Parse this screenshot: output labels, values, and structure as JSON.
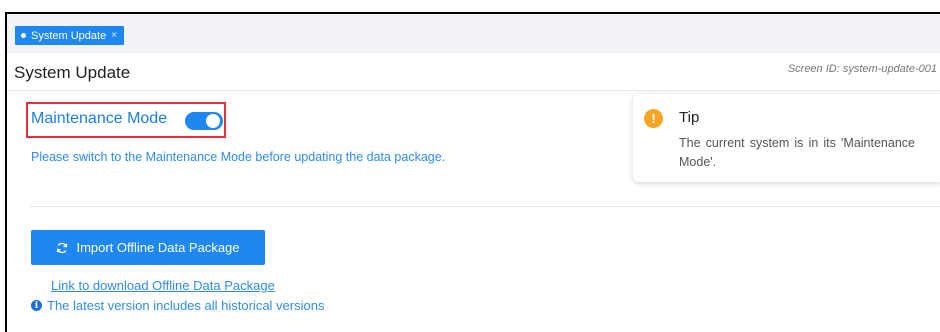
{
  "tab": {
    "label": "System Update",
    "close": "×"
  },
  "header": {
    "title": "System Update",
    "screen_id": "Screen ID: system-update-001"
  },
  "maintenance": {
    "label": "Maintenance Mode",
    "enabled": true,
    "hint": "Please switch to the Maintenance Mode before updating the data package."
  },
  "actions": {
    "import_label": "Import Offline Data Package",
    "download_link": "Link to download Offline Data Package",
    "info_text": "The latest version includes all historical versions"
  },
  "tip": {
    "title": "Tip",
    "text": "The current system is in its 'Maintenance Mode'."
  },
  "colors": {
    "accent": "#1f87f0",
    "highlight_border": "#e8303a",
    "warning": "#f5a524"
  }
}
